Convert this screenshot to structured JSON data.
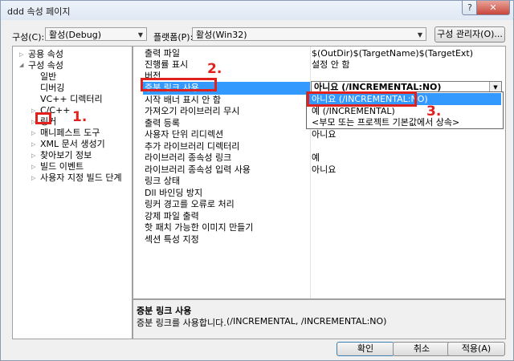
{
  "window": {
    "title": "ddd 속성 페이지",
    "help": "?",
    "close": "✕"
  },
  "toolbar": {
    "config_label": "구성(C):",
    "config_value": "활성(Debug)",
    "platform_label": "플랫폼(P):",
    "platform_value": "활성(Win32)",
    "config_manager": "구성 관리자(O)..."
  },
  "tree": [
    "공용 속성",
    "구성 속성",
    "일반",
    "디버깅",
    "VC++ 디렉터리",
    "C/C++",
    "링커",
    "매니페스트 도구",
    "XML 문서 생성기",
    "찾아보기 정보",
    "빌드 이벤트",
    "사용자 지정 빌드 단계"
  ],
  "properties": [
    {
      "name": "출력 파일",
      "value": "$(OutDir)$(TargetName)$(TargetExt)"
    },
    {
      "name": "진행률 표시",
      "value": "설정 안 함"
    },
    {
      "name": "버전",
      "value": ""
    },
    {
      "name": "증분 링크 사용",
      "value": "아니요 (/INCREMENTAL:NO)"
    },
    {
      "name": "시작 배너 표시 안 함",
      "value": ""
    },
    {
      "name": "가져오기 라이브러리 무시",
      "value": ""
    },
    {
      "name": "출력 등록",
      "value": ""
    },
    {
      "name": "사용자 단위 리디렉션",
      "value": "아니요"
    },
    {
      "name": "추가 라이브러리 디렉터리",
      "value": ""
    },
    {
      "name": "라이브러리 종속성 링크",
      "value": "예"
    },
    {
      "name": "라이브러리 종속성 입력 사용",
      "value": "아니요"
    },
    {
      "name": "링크 상태",
      "value": ""
    },
    {
      "name": "Dll 바인딩 방지",
      "value": ""
    },
    {
      "name": "링커 경고를 오류로 처리",
      "value": ""
    },
    {
      "name": "강제 파일 출력",
      "value": ""
    },
    {
      "name": "핫 패치 가능한 이미지 만들기",
      "value": ""
    },
    {
      "name": "섹션 특성 지정",
      "value": ""
    }
  ],
  "dropdown": {
    "options": [
      "아니요 (/INCREMENTAL:NO)",
      "예 (/INCREMENTAL)",
      "<부모 또는 프로젝트 기본값에서 상속>"
    ]
  },
  "description": {
    "title": "증분 링크 사용",
    "text": "증분 링크를 사용합니다.",
    "switches": "(/INCREMENTAL, /INCREMENTAL:NO)"
  },
  "buttons": {
    "ok": "확인",
    "cancel": "취소",
    "apply": "적용(A)"
  },
  "annotations": {
    "step1": "1.",
    "step2": "2.",
    "step3": "3."
  },
  "colors": {
    "highlight": "#3399ff",
    "annotation": "#e0211d"
  }
}
